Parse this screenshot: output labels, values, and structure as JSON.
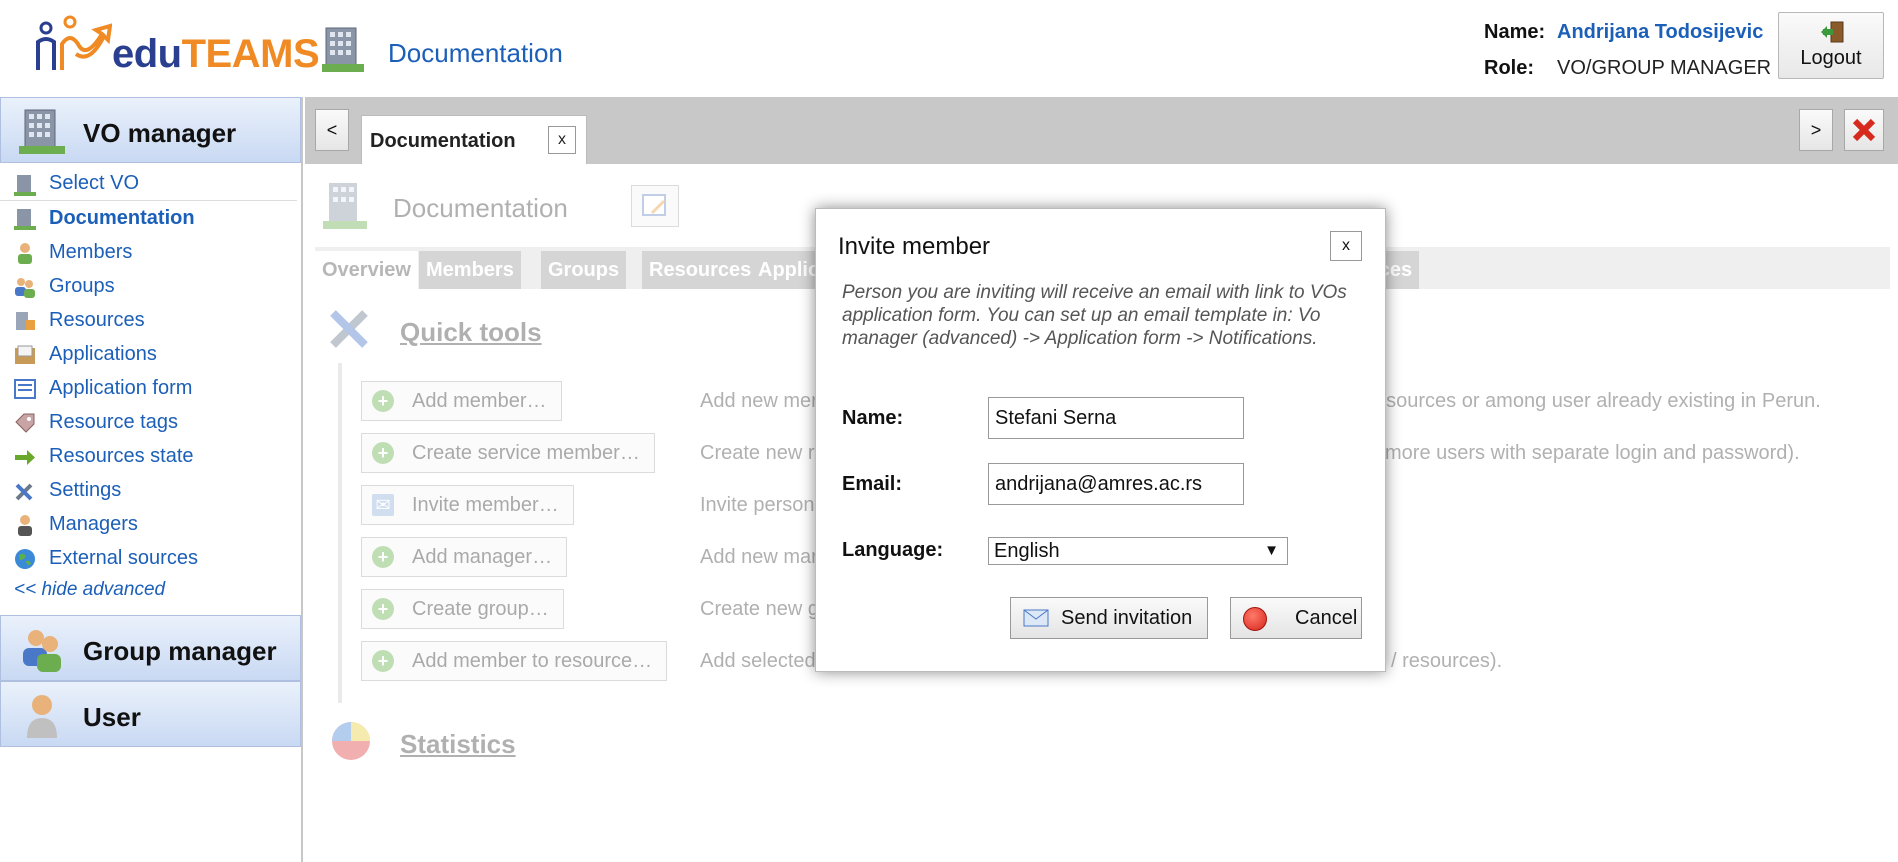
{
  "header": {
    "logo_edu": "edu",
    "logo_teams": "TEAMS",
    "title": "Documentation",
    "name_label": "Name:",
    "name_value": "Andrijana Todosijevic",
    "role_label": "Role:",
    "role_value": "VO/GROUP MANAGER",
    "logout_label": "Logout"
  },
  "sidebar": {
    "vo_manager_title": "VO manager",
    "items": [
      {
        "label": "Select VO",
        "icon": "building-icon"
      },
      {
        "label": "Documentation",
        "icon": "building-icon",
        "active": true
      },
      {
        "label": "Members",
        "icon": "member-icon"
      },
      {
        "label": "Groups",
        "icon": "group-icon"
      },
      {
        "label": "Resources",
        "icon": "resource-icon"
      },
      {
        "label": "Applications",
        "icon": "inbox-icon"
      },
      {
        "label": "Application form",
        "icon": "form-icon"
      },
      {
        "label": "Resource tags",
        "icon": "tag-icon"
      },
      {
        "label": "Resources state",
        "icon": "arrow-right-icon"
      },
      {
        "label": "Settings",
        "icon": "tools-icon"
      },
      {
        "label": "Managers",
        "icon": "manager-icon"
      },
      {
        "label": "External sources",
        "icon": "globe-icon"
      }
    ],
    "hide_advanced": "<< hide advanced",
    "group_manager_title": "Group manager",
    "user_title": "User"
  },
  "tabbar": {
    "prev": "<",
    "next": ">",
    "tab_label": "Documentation",
    "tab_close": "x"
  },
  "page": {
    "title": "Documentation",
    "subtabs": [
      "Overview",
      "Members",
      "Groups",
      "Resources",
      "Applic",
      "rces"
    ],
    "quick_tools_title": "Quick tools",
    "quick_tools": [
      {
        "label": "Add member…",
        "desc": "Add new mer"
      },
      {
        "label": "Create service member…",
        "desc": "Create new r"
      },
      {
        "label": "Invite member…",
        "desc": "Invite person"
      },
      {
        "label": "Add manager…",
        "desc": "Add new mar"
      },
      {
        "label": "Create group…",
        "desc": "Create new g"
      },
      {
        "label": "Add member to resource…",
        "desc": "Add selected"
      }
    ],
    "desc_right_1": "al sources or among user already existing in Perun.",
    "desc_right_2": "more users with separate login and password).",
    "desc_right_6": "/ resources).",
    "statistics_title": "Statistics"
  },
  "dialog": {
    "title": "Invite member",
    "close": "x",
    "info": "Person you are inviting will receive an email with link to VOs application form. You can set up an email template in: Vo manager (advanced) -> Application form -> Notifications.",
    "name_label": "Name:",
    "name_value": "Stefani Serna",
    "email_label": "Email:",
    "email_value": "andrijana@amres.ac.rs",
    "language_label": "Language:",
    "language_value": "English",
    "language_arrow": "▼",
    "send_label": "Send invitation",
    "cancel_label": "Cancel"
  }
}
